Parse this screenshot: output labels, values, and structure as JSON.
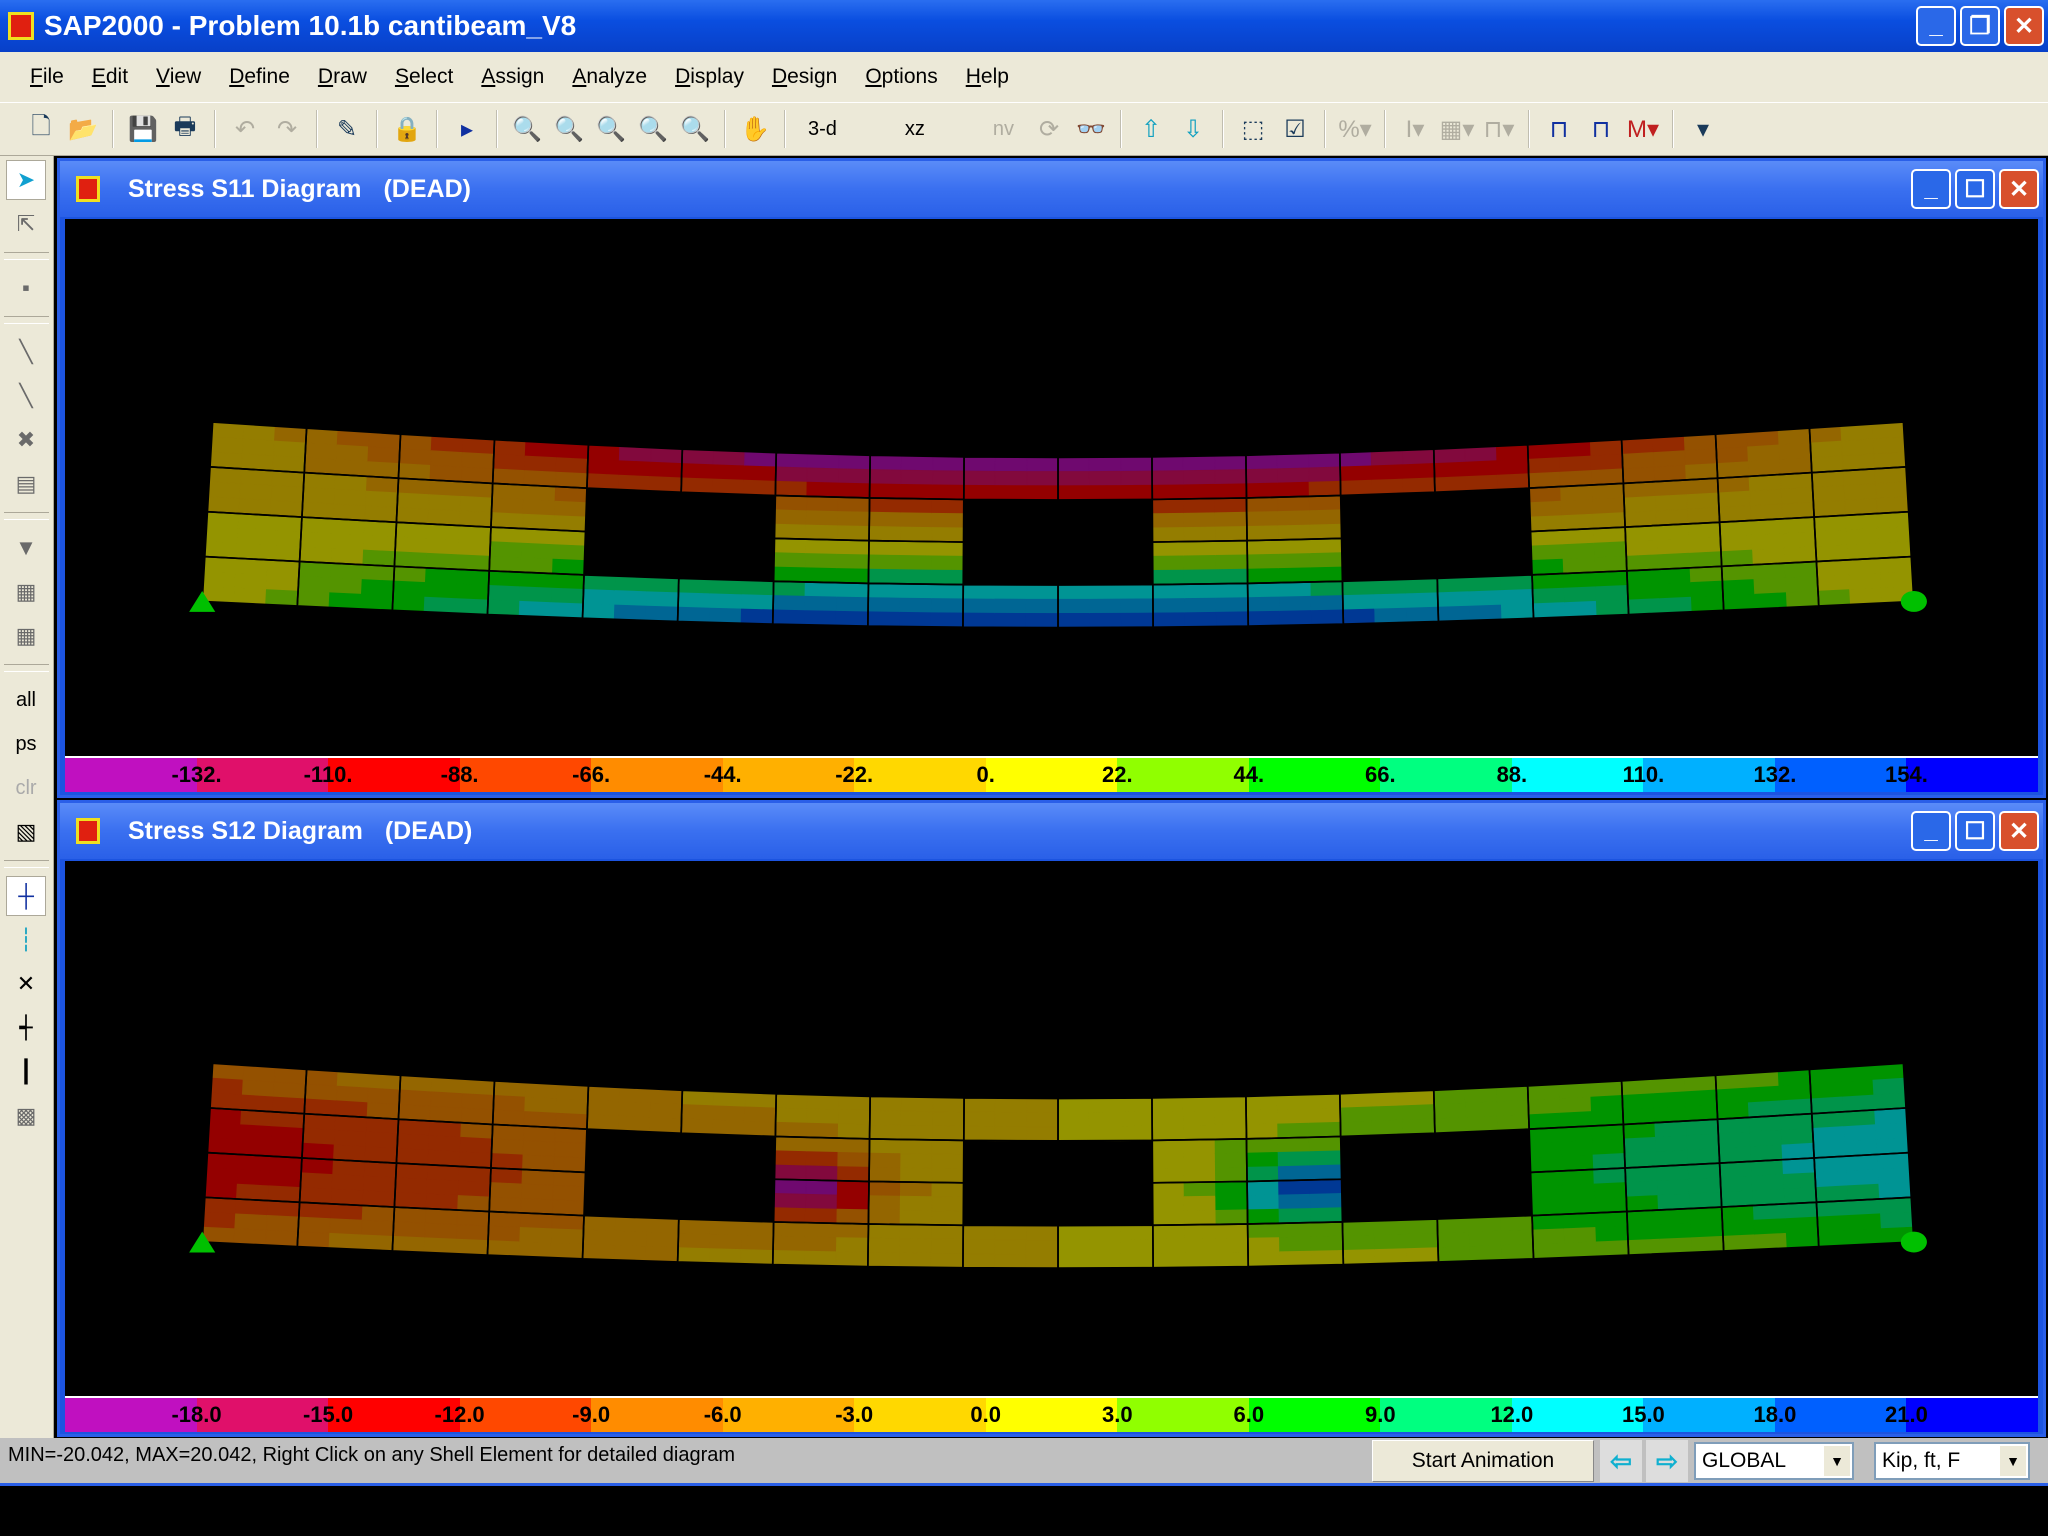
{
  "app": {
    "title": "SAP2000 - Problem 10.1b cantibeam_V8"
  },
  "menu": [
    "File",
    "Edit",
    "View",
    "Define",
    "Draw",
    "Select",
    "Assign",
    "Analyze",
    "Display",
    "Design",
    "Options",
    "Help"
  ],
  "toolbar": {
    "view_3d": "3-d",
    "view_xz": "xz",
    "view_nv": "nv"
  },
  "left_toolbar": {
    "all": "all",
    "ps": "ps",
    "clr": "clr"
  },
  "windows": [
    {
      "title": "Stress S11 Diagram",
      "case": "(DEAD)",
      "colorbar": [
        "-132.",
        "-110.",
        "-88.",
        "-66.",
        "-44.",
        "-22.",
        "0.",
        "22.",
        "44.",
        "66.",
        "88.",
        "110.",
        "132.",
        "154."
      ]
    },
    {
      "title": "Stress S12 Diagram",
      "case": "(DEAD)",
      "colorbar": [
        "-18.0",
        "-15.0",
        "-12.0",
        "-9.0",
        "-6.0",
        "-3.0",
        "0.0",
        "3.0",
        "6.0",
        "9.0",
        "12.0",
        "15.0",
        "18.0",
        "21.0"
      ]
    }
  ],
  "colorbar_colors": [
    "#c010c0",
    "#e0106a",
    "#ff0000",
    "#ff4800",
    "#ff8c00",
    "#ffb000",
    "#ffd800",
    "#ffff00",
    "#90ff00",
    "#00ff00",
    "#00ff80",
    "#00ffff",
    "#00b0ff",
    "#0060ff",
    "#0000ff"
  ],
  "status": {
    "text": "MIN=-20.042, MAX=20.042, Right Click on any Shell Element for detailed diagram",
    "animation_button": "Start Animation",
    "coord_system": "GLOBAL",
    "units": "Kip, ft, F"
  }
}
